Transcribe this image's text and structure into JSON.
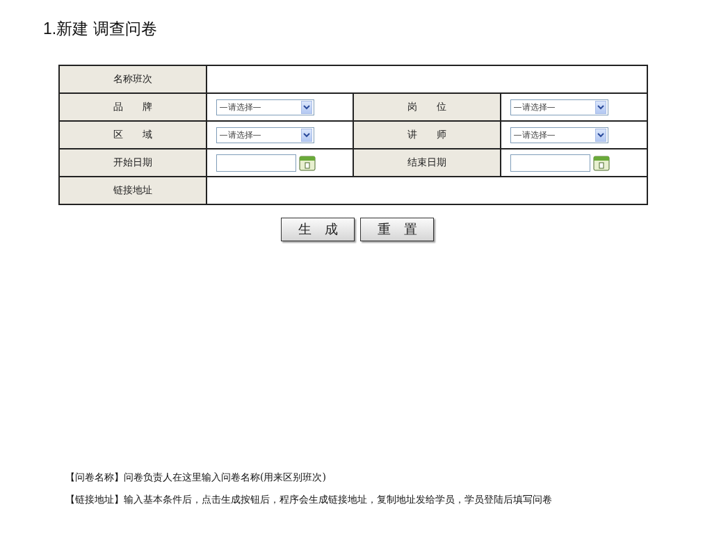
{
  "title": "1.新建 调查问卷",
  "form_rows": [
    {
      "kind": "wide",
      "label": "名称班次"
    },
    {
      "kind": "pair",
      "fields": [
        {
          "label": "品　　牌",
          "kind": "select",
          "value": "—请选择—"
        },
        {
          "label": "岗　　位",
          "kind": "select",
          "value": "—请选择—"
        }
      ]
    },
    {
      "kind": "pair",
      "fields": [
        {
          "label": "区　　域",
          "kind": "select",
          "value": "—请选择—"
        },
        {
          "label": "讲　　师",
          "kind": "select",
          "value": "—请选择—"
        }
      ]
    },
    {
      "kind": "pair",
      "fields": [
        {
          "label": "开始日期",
          "kind": "date"
        },
        {
          "label": "结束日期",
          "kind": "date"
        }
      ]
    },
    {
      "kind": "wide",
      "label": "链接地址"
    }
  ],
  "buttons": [
    "生　成",
    "重　置"
  ],
  "notes": [
    "【问卷名称】问卷负责人在这里输入问卷名称(用来区别班次)",
    "【链接地址】输入基本条件后，点击生成按钮后，程序会生成链接地址，复制地址发给学员，学员登陆后填写问卷"
  ]
}
